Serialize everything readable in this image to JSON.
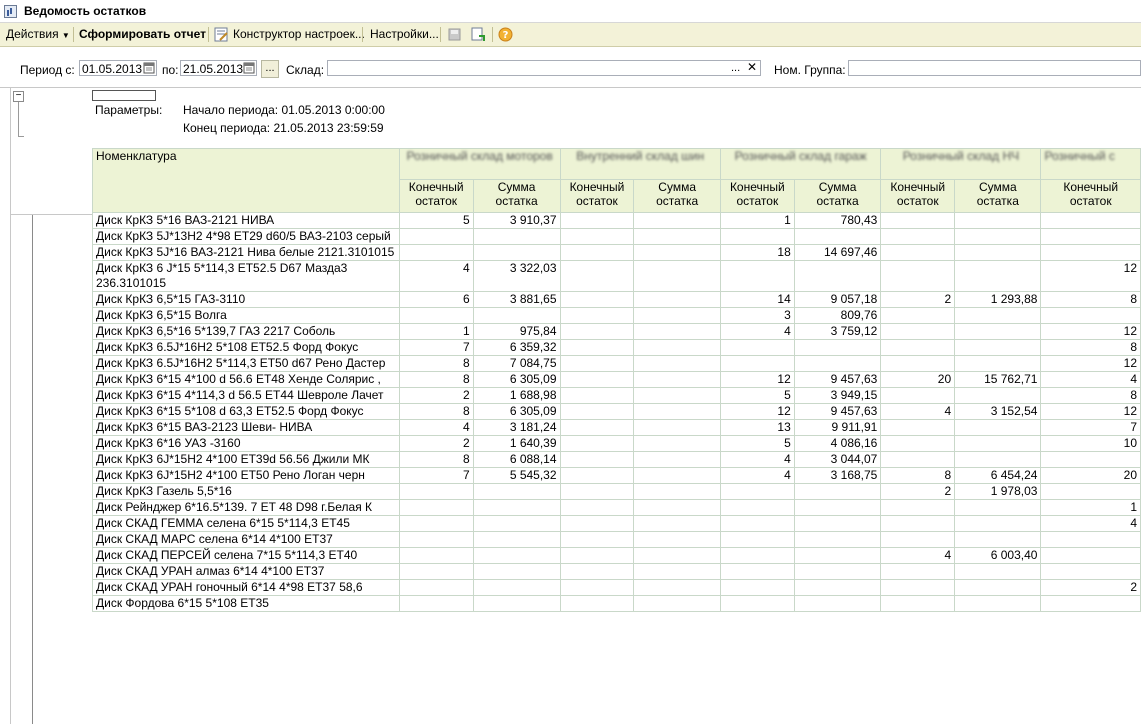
{
  "window": {
    "title": "Ведомость остатков"
  },
  "toolbar": {
    "actions": "Действия",
    "generate": "Сформировать отчет",
    "constructor": "Конструктор настроек...",
    "settings": "Настройки..."
  },
  "filters": {
    "period_label": "Период с:",
    "period_from": "01.05.2013",
    "period_to_label": "по:",
    "period_to": "21.05.2013",
    "warehouse_label": "Склад:",
    "warehouse_value": "",
    "group_label": "Ном. Группа:",
    "group_value": ""
  },
  "report": {
    "params_label": "Параметры:",
    "period_start": "Начало периода: 01.05.2013 0:00:00",
    "period_end": "Конец периода: 21.05.2013 23:59:59",
    "nom_header": "Номенклатура",
    "warehouses": [
      "Розничный склад моторов",
      "Внутренний склад шин",
      "Розничный склад гараж",
      "Розничный склад НЧ",
      "Розничный с"
    ],
    "sub_qty": "Конечный остаток",
    "sub_sum": "Сумма остатка",
    "rows": [
      {
        "name": "Диск КрКЗ  5*16  ВАЗ-2121 НИВА",
        "c": [
          "5",
          "3 910,37",
          "",
          "",
          "1",
          "780,43",
          "",
          "",
          ""
        ]
      },
      {
        "name": "Диск КрКЗ  5J*13Н2 4*98 ET29 d60/5  ВАЗ-2103 серый",
        "c": [
          "",
          "",
          "",
          "",
          "",
          "",
          "",
          "",
          ""
        ]
      },
      {
        "name": "Диск КрКЗ  5J*16  ВАЗ-2121 Нива белые 2121.3101015",
        "c": [
          "",
          "",
          "",
          "",
          "18",
          "14 697,46",
          "",
          "",
          ""
        ]
      },
      {
        "name": "Диск КрКЗ  6 J*15  5*114,3  ET52.5 D67 Мазда3 236.3101015",
        "c": [
          "4",
          "3 322,03",
          "",
          "",
          "",
          "",
          "",
          "",
          "12"
        ]
      },
      {
        "name": "Диск КрКЗ  6,5*15  ГАЗ-3110",
        "c": [
          "6",
          "3 881,65",
          "",
          "",
          "14",
          "9 057,18",
          "2",
          "1 293,88",
          "8"
        ]
      },
      {
        "name": "Диск КрКЗ  6,5*15 Волга",
        "c": [
          "",
          "",
          "",
          "",
          "3",
          "809,76",
          "",
          "",
          ""
        ]
      },
      {
        "name": "Диск КрКЗ  6,5*16 5*139,7  ГАЗ 2217 Соболь",
        "c": [
          "1",
          "975,84",
          "",
          "",
          "4",
          "3 759,12",
          "",
          "",
          "12"
        ]
      },
      {
        "name": "Диск КрКЗ  6.5J*16Н2  5*108  ET52.5 Форд Фокус",
        "c": [
          "7",
          "6 359,32",
          "",
          "",
          "",
          "",
          "",
          "",
          "8"
        ]
      },
      {
        "name": "Диск КрКЗ  6.5J*16Н2  5*114,3 ET50 d67  Рено Дастер",
        "c": [
          "8",
          "7 084,75",
          "",
          "",
          "",
          "",
          "",
          "",
          "12"
        ]
      },
      {
        "name": "Диск КрКЗ  6*15  4*100 d 56.6 ET48 Хенде Солярис ,",
        "c": [
          "8",
          "6 305,09",
          "",
          "",
          "12",
          "9 457,63",
          "20",
          "15 762,71",
          "4"
        ]
      },
      {
        "name": "Диск КрКЗ  6*15  4*114,3 d 56.5 ET44 Шевроле Лачет",
        "c": [
          "2",
          "1 688,98",
          "",
          "",
          "5",
          "3 949,15",
          "",
          "",
          "8"
        ]
      },
      {
        "name": "Диск КрКЗ  6*15  5*108 d 63,3 ET52.5 Форд Фокус",
        "c": [
          "8",
          "6 305,09",
          "",
          "",
          "12",
          "9 457,63",
          "4",
          "3 152,54",
          "12"
        ]
      },
      {
        "name": "Диск КрКЗ  6*15  ВАЗ-2123 Шеви- НИВА",
        "c": [
          "4",
          "3 181,24",
          "",
          "",
          "13",
          "9 911,91",
          "",
          "",
          "7"
        ]
      },
      {
        "name": "Диск КрКЗ  6*16  УАЗ -3160",
        "c": [
          "2",
          "1 640,39",
          "",
          "",
          "5",
          "4 086,16",
          "",
          "",
          "10"
        ]
      },
      {
        "name": "Диск КрКЗ  6J*15Н2  4*100 ET39d 56.56 Джили МК",
        "c": [
          "8",
          "6 088,14",
          "",
          "",
          "4",
          "3 044,07",
          "",
          "",
          ""
        ]
      },
      {
        "name": "Диск КрКЗ  6J*15Н2  4*100 ET50  Рено Логан черн",
        "c": [
          "7",
          "5 545,32",
          "",
          "",
          "4",
          "3 168,75",
          "8",
          "6 454,24",
          "20"
        ]
      },
      {
        "name": "Диск КрКЗ Газель 5,5*16",
        "c": [
          "",
          "",
          "",
          "",
          "",
          "",
          "2",
          "1 978,03",
          ""
        ]
      },
      {
        "name": "Диск Рейнджер 6*16.5*139. 7  ET 48  D98 г.Белая К",
        "c": [
          "",
          "",
          "",
          "",
          "",
          "",
          "",
          "",
          "1"
        ]
      },
      {
        "name": "Диск СКАД ГЕММА селена 6*15 5*114,3 ET45",
        "c": [
          "",
          "",
          "",
          "",
          "",
          "",
          "",
          "",
          "4"
        ]
      },
      {
        "name": "Диск СКАД МАРС селена 6*14 4*100 ET37",
        "c": [
          "",
          "",
          "",
          "",
          "",
          "",
          "",
          "",
          ""
        ]
      },
      {
        "name": "Диск СКАД ПЕРСЕЙ селена 7*15 5*114,3 ET40",
        "c": [
          "",
          "",
          "",
          "",
          "",
          "",
          "4",
          "6 003,40",
          ""
        ]
      },
      {
        "name": "Диск СКАД УРАН алмаз 6*14 4*100 ET37",
        "c": [
          "",
          "",
          "",
          "",
          "",
          "",
          "",
          "",
          ""
        ]
      },
      {
        "name": "Диск СКАД УРАН гоночный 6*14 4*98 ET37 58,6",
        "c": [
          "",
          "",
          "",
          "",
          "",
          "",
          "",
          "",
          "2"
        ]
      },
      {
        "name": "Диск Фордова 6*15 5*108 ET35",
        "c": [
          "",
          "",
          "",
          "",
          "",
          "",
          "",
          "",
          ""
        ]
      }
    ]
  }
}
